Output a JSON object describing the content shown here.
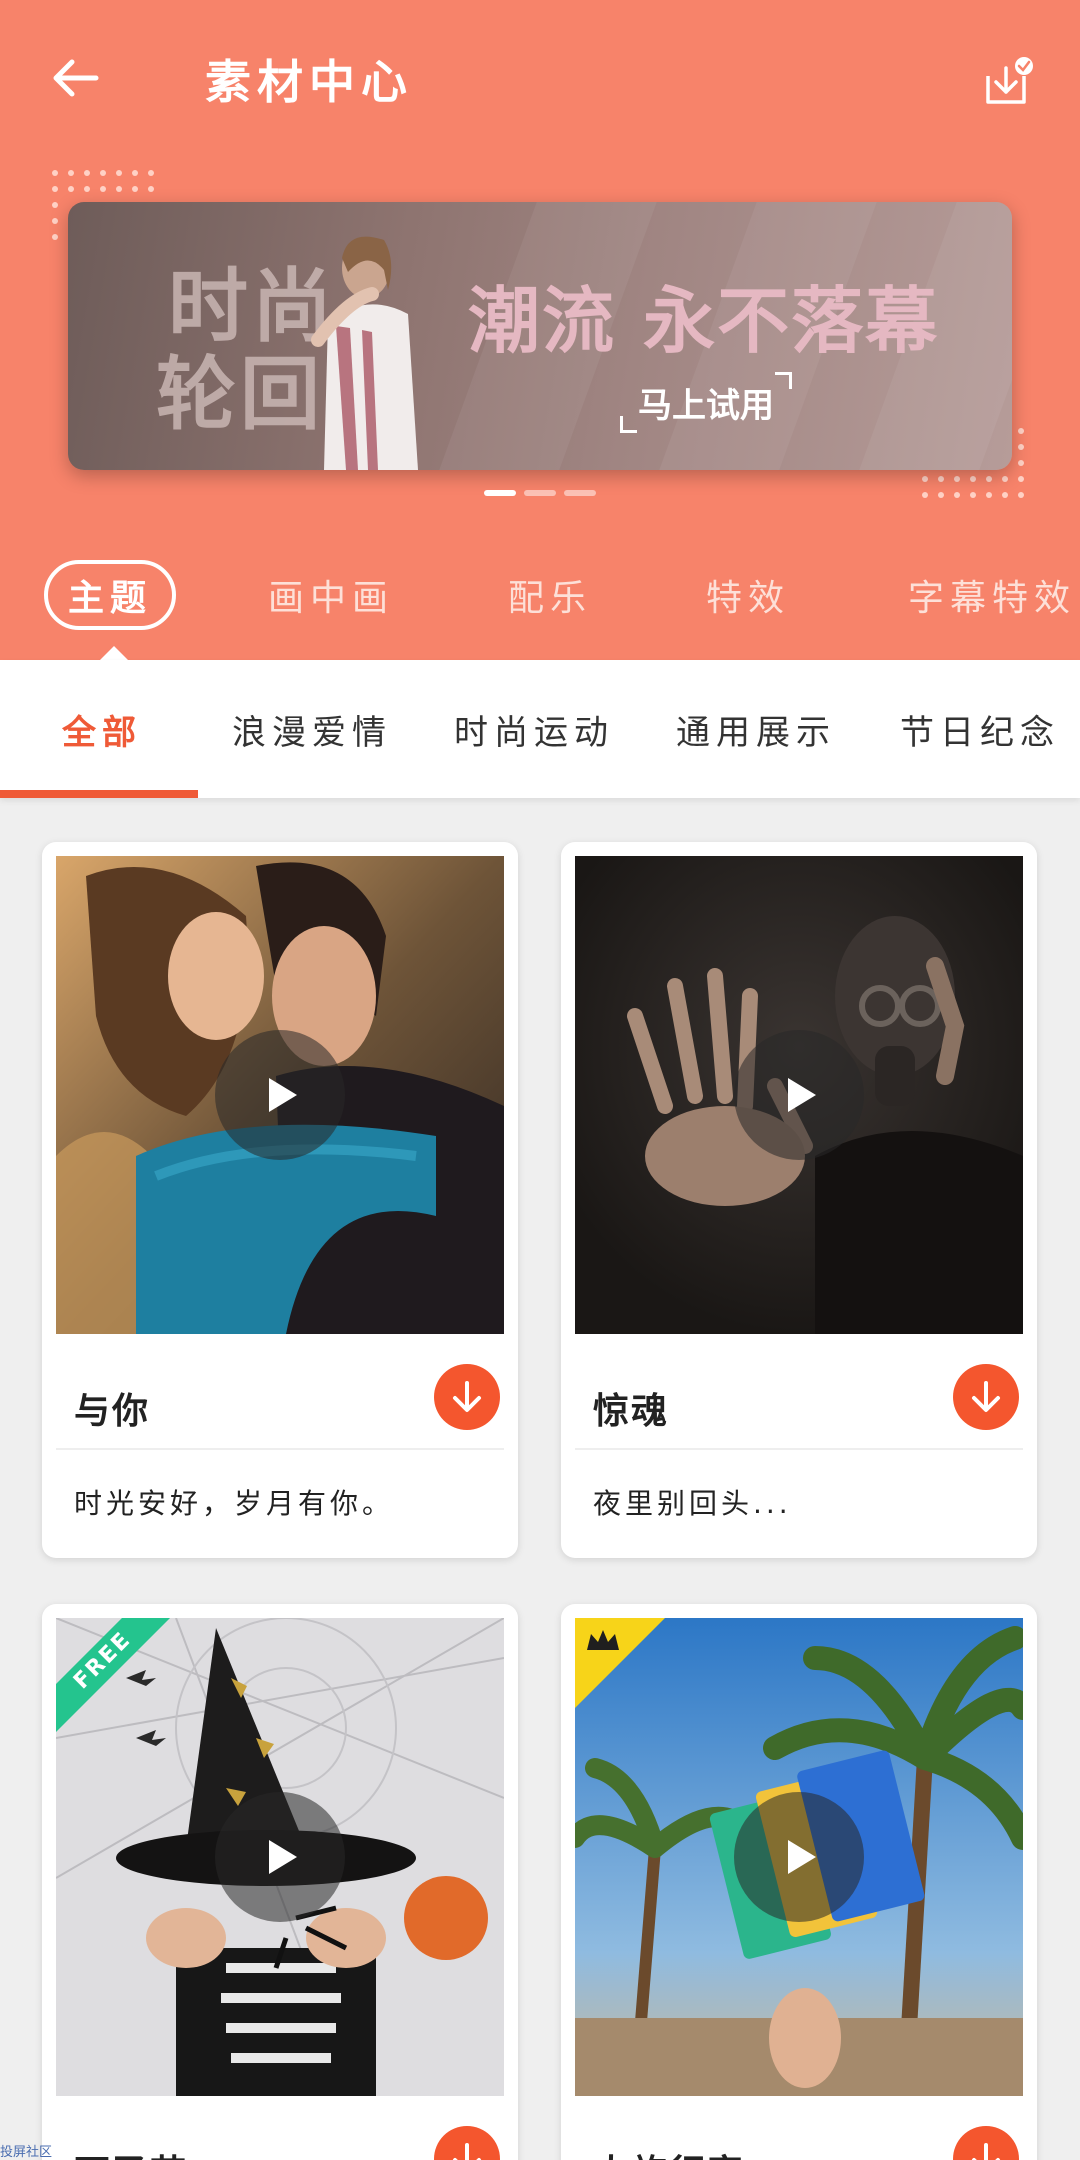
{
  "header": {
    "title": "素材中心",
    "back_icon": "arrow-left-icon",
    "download_icon": "download-check-icon"
  },
  "banner": {
    "left_line1": "时尚",
    "left_line2": "轮回",
    "slogan": "潮流 永不落幕",
    "cta": "马上试用",
    "page_count": 3,
    "active_page": 1
  },
  "category_tabs": [
    {
      "label": "主题",
      "active": true
    },
    {
      "label": "画中画",
      "active": false
    },
    {
      "label": "配乐",
      "active": false
    },
    {
      "label": "特效",
      "active": false
    },
    {
      "label": "字幕特效",
      "active": false
    }
  ],
  "sub_tabs": [
    {
      "label": "全部",
      "active": true
    },
    {
      "label": "浪漫爱情",
      "active": false
    },
    {
      "label": "时尚运动",
      "active": false
    },
    {
      "label": "通用展示",
      "active": false
    },
    {
      "label": "节日纪念",
      "active": false
    }
  ],
  "cards": [
    {
      "title": "与你",
      "desc": "时光安好，岁月有你。",
      "badge": ""
    },
    {
      "title": "惊魂",
      "desc": "夜里别回头...",
      "badge": ""
    },
    {
      "title": "万圣节",
      "desc": "",
      "badge": "FREE"
    },
    {
      "title": "大旅行家",
      "desc": "",
      "badge": "vip"
    }
  ],
  "watermark": "投屏社区",
  "colors": {
    "header_bg": "#f7836a",
    "accent": "#ef5a37",
    "download_button": "#f4562e",
    "free_badge": "#24c48e",
    "vip_badge": "#f7d419"
  }
}
